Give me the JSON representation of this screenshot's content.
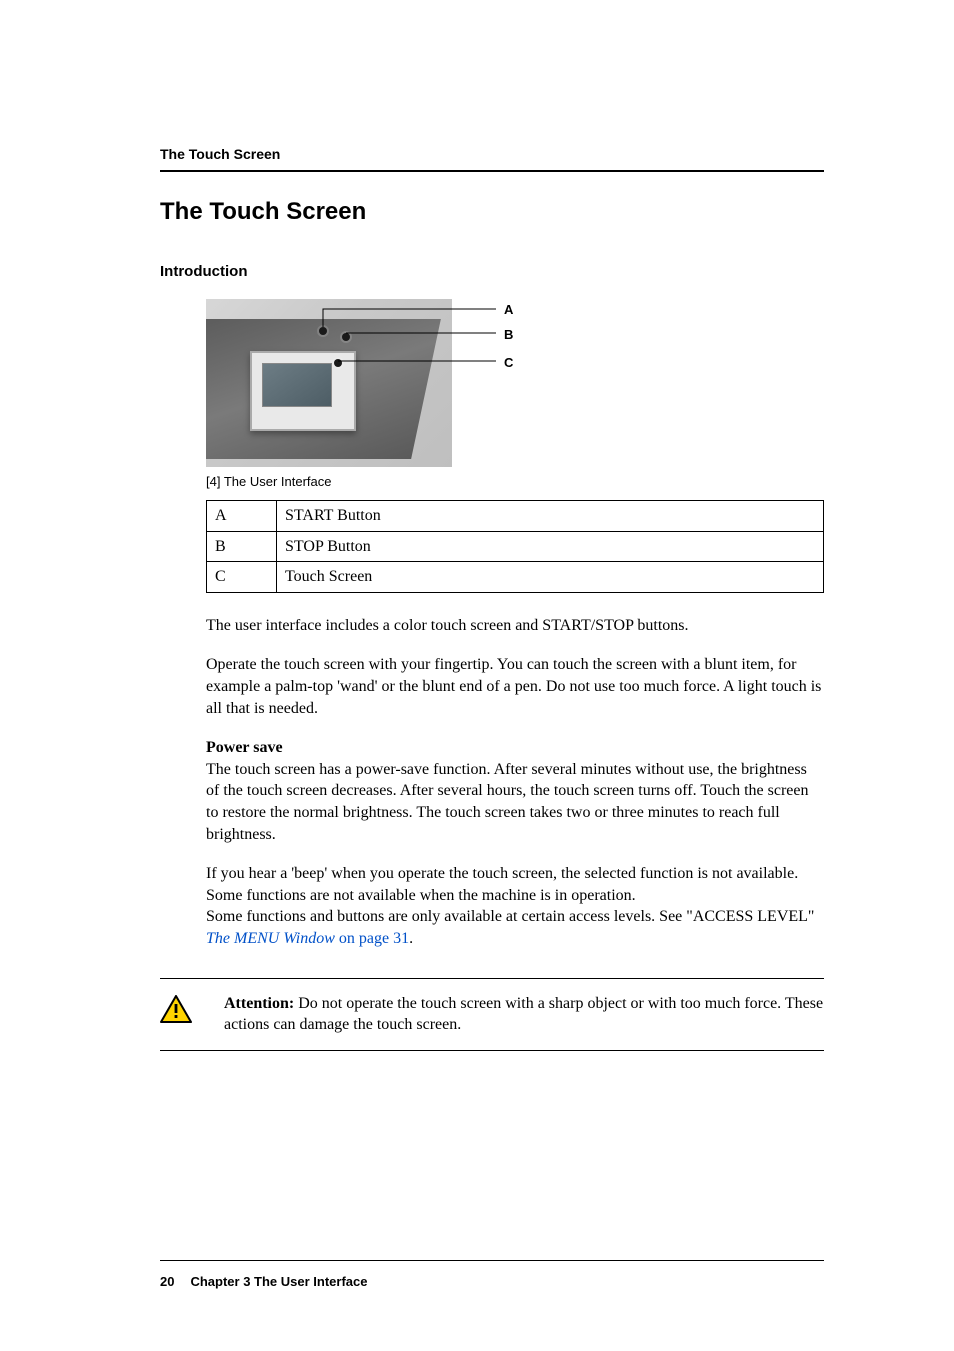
{
  "running_head": "The Touch Screen",
  "section_title": "The Touch Screen",
  "intro_heading": "Introduction",
  "figure": {
    "labels": {
      "a": "A",
      "b": "B",
      "c": "C"
    },
    "caption": "[4] The User Interface"
  },
  "legend": {
    "rows": [
      {
        "key": "A",
        "desc": "START Button"
      },
      {
        "key": "B",
        "desc": "STOP Button"
      },
      {
        "key": "C",
        "desc": "Touch Screen"
      }
    ]
  },
  "paragraphs": {
    "p1": "The user interface includes a color touch screen and START/STOP buttons.",
    "p2": "Operate the touch screen with your fingertip. You can touch the screen with a blunt item, for example a palm-top 'wand' or the blunt end of a pen. Do not use too much force. A light touch is all that is needed.",
    "power_save_head": "Power save",
    "p3": "The touch screen has a power-save function. After several minutes without use, the brightness of the touch screen decreases. After several hours, the touch screen turns off. Touch the screen to restore the normal brightness. The touch screen takes two or three minutes to reach full brightness.",
    "p4a": "If you hear a 'beep' when you operate the touch screen, the selected function is not available. Some functions are not available when the machine is in operation.",
    "p4b_prefix": "Some functions and buttons are only available at certain access levels. See \"ACCESS LEVEL\" ",
    "p4b_link_italic": "The MENU Window",
    "p4b_link_rest": " on page 31",
    "p4b_suffix": "."
  },
  "attention": {
    "label": "Attention:",
    "text": " Do not operate the touch screen with a sharp object or with too much force. These actions can damage the touch screen."
  },
  "footer": {
    "page_number": "20",
    "chapter": "Chapter 3 The User Interface"
  },
  "icons": {
    "warning_name": "warning-triangle-icon"
  }
}
